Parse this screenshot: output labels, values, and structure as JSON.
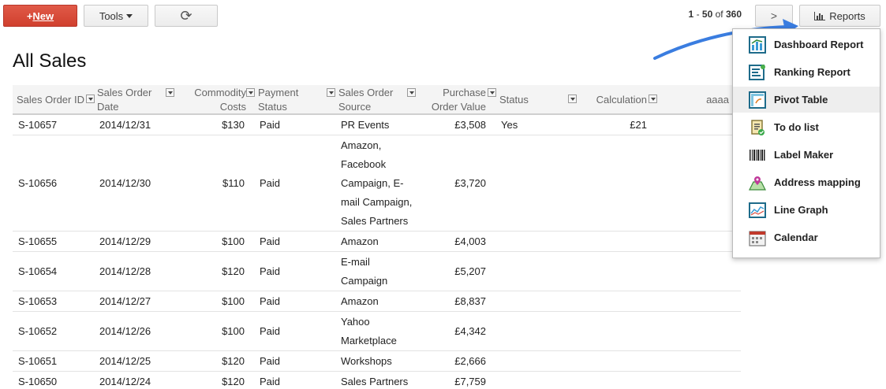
{
  "toolbar": {
    "new_label": "New",
    "tools_label": "Tools",
    "refresh_glyph": "⟳",
    "next_glyph": ">",
    "reports_label": "Reports",
    "pager": {
      "from": "1",
      "to": "50",
      "of_text": "of",
      "total": "360"
    }
  },
  "page_title": "All Sales",
  "columns": {
    "order_id": "Sales Order ID",
    "order_date_1": "Sales Order",
    "order_date_2": "Date",
    "commodity_1": "Commodity",
    "commodity_2": "Costs",
    "payment_1": "Payment",
    "payment_2": "Status",
    "source_1": "Sales Order",
    "source_2": "Source",
    "purchase_1": "Purchase",
    "purchase_2": "Order Value",
    "status": "Status",
    "calculation": "Calculation",
    "aaaa": "aaaa"
  },
  "rows": [
    {
      "id": "S-10657",
      "date": "2014/12/31",
      "cost": "$130",
      "pay": "Paid",
      "src": [
        "PR Events"
      ],
      "value": "£3,508",
      "status": "Yes",
      "calc": "£21"
    },
    {
      "id": "S-10656",
      "date": "2014/12/30",
      "cost": "$110",
      "pay": "Paid",
      "src": [
        "Amazon,",
        "Facebook",
        "Campaign, E-",
        "mail Campaign,",
        "Sales Partners"
      ],
      "value": "£3,720",
      "status": "",
      "calc": ""
    },
    {
      "id": "S-10655",
      "date": "2014/12/29",
      "cost": "$100",
      "pay": "Paid",
      "src": [
        "Amazon"
      ],
      "value": "£4,003",
      "status": "",
      "calc": ""
    },
    {
      "id": "S-10654",
      "date": "2014/12/28",
      "cost": "$120",
      "pay": "Paid",
      "src": [
        "E-mail",
        "Campaign"
      ],
      "value": "£5,207",
      "status": "",
      "calc": ""
    },
    {
      "id": "S-10653",
      "date": "2014/12/27",
      "cost": "$100",
      "pay": "Paid",
      "src": [
        "Amazon"
      ],
      "value": "£8,837",
      "status": "",
      "calc": ""
    },
    {
      "id": "S-10652",
      "date": "2014/12/26",
      "cost": "$100",
      "pay": "Paid",
      "src": [
        "Yahoo",
        "Marketplace"
      ],
      "value": "£4,342",
      "status": "",
      "calc": ""
    },
    {
      "id": "S-10651",
      "date": "2014/12/25",
      "cost": "$120",
      "pay": "Paid",
      "src": [
        "Workshops"
      ],
      "value": "£2,666",
      "status": "",
      "calc": ""
    },
    {
      "id": "S-10650",
      "date": "2014/12/24",
      "cost": "$120",
      "pay": "Paid",
      "src": [
        "Sales Partners"
      ],
      "value": "£7,759",
      "status": "",
      "calc": ""
    }
  ],
  "reports_menu": [
    {
      "label": "Dashboard Report",
      "icon": "dashboard-report-icon"
    },
    {
      "label": "Ranking Report",
      "icon": "ranking-report-icon"
    },
    {
      "label": "Pivot Table",
      "icon": "pivot-table-icon",
      "highlighted": true
    },
    {
      "label": "To do list",
      "icon": "todo-list-icon"
    },
    {
      "label": "Label Maker",
      "icon": "barcode-icon"
    },
    {
      "label": "Address mapping",
      "icon": "map-pin-icon"
    },
    {
      "label": "Line Graph",
      "icon": "line-graph-icon"
    },
    {
      "label": "Calendar",
      "icon": "calendar-icon"
    }
  ],
  "colors": {
    "new_button": "#d84a38",
    "arrow": "#3a7de0",
    "header_bg": "#f4f4f4"
  }
}
